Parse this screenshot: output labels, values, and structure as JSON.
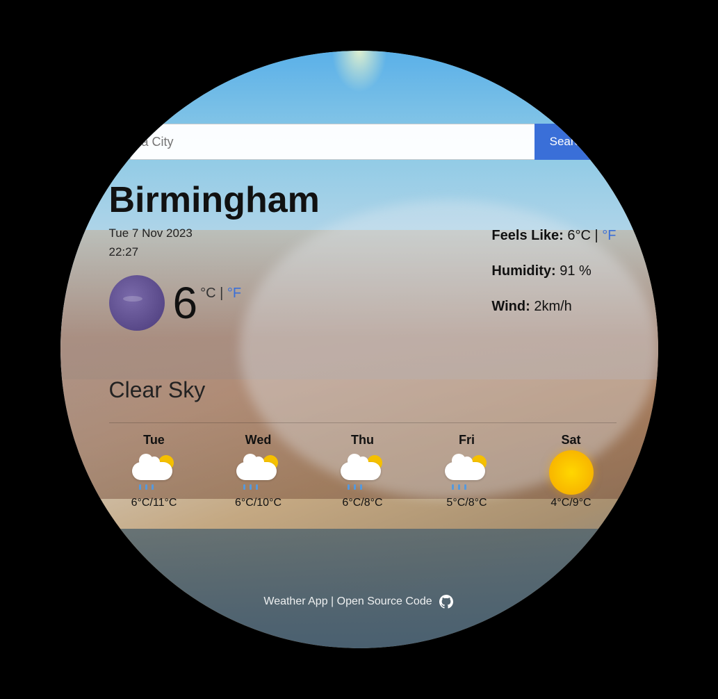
{
  "search": {
    "placeholder": "a City",
    "button_label": "Search"
  },
  "city": "Birmingham",
  "date": "Tue 7 Nov 2023",
  "time": "22:27",
  "temperature": {
    "value": "6",
    "unit_celsius": "°C",
    "unit_separator": "|",
    "unit_fahrenheit": "°F"
  },
  "condition": "Clear Sky",
  "feels_like": {
    "label": "Feels Like:",
    "value": "6°C",
    "separator": "|",
    "fahrenheit": "°F"
  },
  "humidity": {
    "label": "Humidity:",
    "value": "91 %"
  },
  "wind": {
    "label": "Wind:",
    "value": "2km/h"
  },
  "forecast": [
    {
      "day": "Tue",
      "icon": "rain-cloud",
      "temp": "6°C/11°C"
    },
    {
      "day": "Wed",
      "icon": "rain-cloud",
      "temp": "6°C/10°C"
    },
    {
      "day": "Thu",
      "icon": "rain-cloud",
      "temp": "6°C/8°C"
    },
    {
      "day": "Fri",
      "icon": "rain-cloud",
      "temp": "5°C/8°C"
    },
    {
      "day": "Sat",
      "icon": "sun",
      "temp": "4°C/9°C"
    }
  ],
  "footer": {
    "label": "Weather App | Open Source Code"
  },
  "colors": {
    "search_button": "#3a6fd8",
    "link_blue": "#3a6fd8"
  }
}
